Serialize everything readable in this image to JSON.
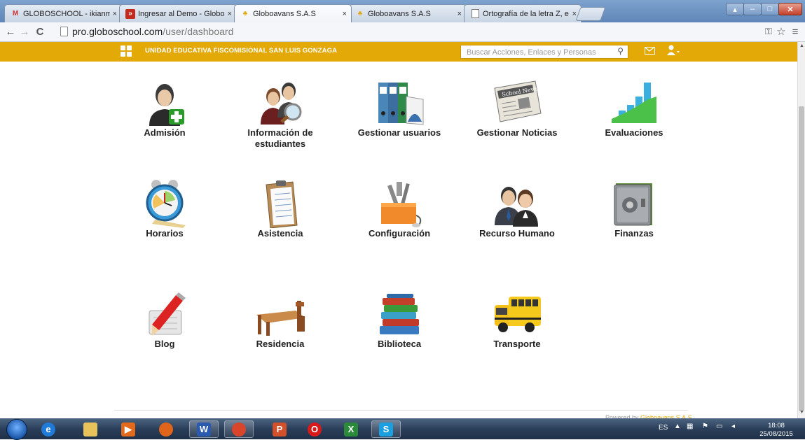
{
  "browser": {
    "tabs": [
      {
        "label": "GLOBOSCHOOL - ikianmo",
        "favicon": "gmail-icon",
        "active": false
      },
      {
        "label": "Ingresar al Demo - Globo",
        "favicon": "site-icon",
        "active": false
      },
      {
        "label": "Globoavans S.A.S",
        "favicon": "globoavans-icon",
        "active": true
      },
      {
        "label": "Globoavans S.A.S",
        "favicon": "globoavans-icon",
        "active": false
      },
      {
        "label": "Ortografía de la letra Z, e",
        "favicon": "page-icon",
        "active": false
      }
    ],
    "close_glyph": "×",
    "url_host": "pro.globoschool.com",
    "url_path": "/user/dashboard"
  },
  "header": {
    "school_name": "UNIDAD EDUCATIVA FISCOMISIONAL SAN LUIS GONZAGA",
    "search_placeholder": "Buscar Acciones, Enlaces y Personas",
    "accent_color": "#e2a907"
  },
  "modules": [
    {
      "label": "Admisión",
      "icon": "admission-user-add-icon"
    },
    {
      "label": "Información de estudiantes",
      "icon": "students-search-icon"
    },
    {
      "label": "Gestionar usuarios",
      "icon": "binders-icon"
    },
    {
      "label": "Gestionar Noticias",
      "icon": "newspaper-icon"
    },
    {
      "label": "Evaluaciones",
      "icon": "bar-chart-icon"
    },
    {
      "label": "Horarios",
      "icon": "alarm-clock-icon"
    },
    {
      "label": "Asistencia",
      "icon": "clipboard-icon"
    },
    {
      "label": "Configuración",
      "icon": "toolbox-icon"
    },
    {
      "label": "Recurso Humano",
      "icon": "people-icon"
    },
    {
      "label": "Finanzas",
      "icon": "safe-icon"
    },
    {
      "label": "Blog",
      "icon": "pencil-icon"
    },
    {
      "label": "Residencia",
      "icon": "bed-icon"
    },
    {
      "label": "Biblioteca",
      "icon": "books-icon"
    },
    {
      "label": "Transporte",
      "icon": "school-bus-icon"
    }
  ],
  "footer": {
    "powered_prefix": "Powered by",
    "powered_brand": "Globoavans S.A.S"
  },
  "taskbar": {
    "apps": [
      {
        "name": "internet-explorer-icon",
        "glyph": "e"
      },
      {
        "name": "file-explorer-icon",
        "glyph": ""
      },
      {
        "name": "media-player-icon",
        "glyph": "▶"
      },
      {
        "name": "firefox-icon",
        "glyph": ""
      },
      {
        "name": "word-icon",
        "glyph": "W"
      },
      {
        "name": "chrome-icon",
        "glyph": ""
      },
      {
        "name": "powerpoint-icon",
        "glyph": "P"
      },
      {
        "name": "opera-icon",
        "glyph": "O"
      },
      {
        "name": "excel-icon",
        "glyph": "X"
      },
      {
        "name": "skype-icon",
        "glyph": "S"
      }
    ],
    "language": "ES",
    "time": "18:08",
    "date": "25/08/2015"
  }
}
